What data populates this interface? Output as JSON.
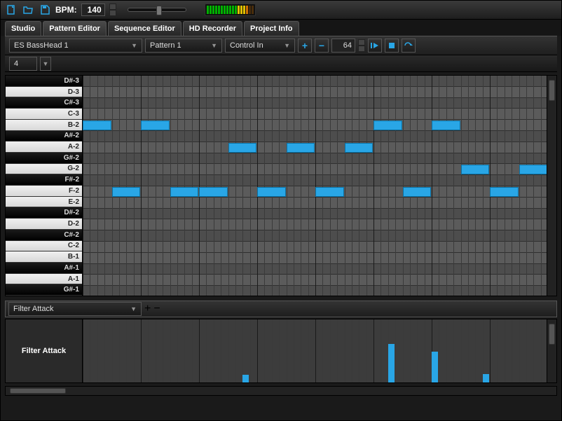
{
  "toolbar": {
    "bpm_label": "BPM:",
    "bpm_value": "140"
  },
  "tabs": [
    "Studio",
    "Pattern Editor",
    "Sequence Editor",
    "HD Recorder",
    "Project Info"
  ],
  "active_tab": 1,
  "sub": {
    "instrument": "ES BassHead 1",
    "pattern": "Pattern 1",
    "control_in": "Control In",
    "steps": "64"
  },
  "zoom": "4",
  "piano": {
    "keys": [
      {
        "n": "D#-3",
        "b": true
      },
      {
        "n": "D-3",
        "b": false
      },
      {
        "n": "C#-3",
        "b": true
      },
      {
        "n": "C-3",
        "b": false
      },
      {
        "n": "B-2",
        "b": false
      },
      {
        "n": "A#-2",
        "b": true
      },
      {
        "n": "A-2",
        "b": false
      },
      {
        "n": "G#-2",
        "b": true
      },
      {
        "n": "G-2",
        "b": false
      },
      {
        "n": "F#-2",
        "b": true
      },
      {
        "n": "F-2",
        "b": false
      },
      {
        "n": "E-2",
        "b": false
      },
      {
        "n": "D#-2",
        "b": true
      },
      {
        "n": "D-2",
        "b": false
      },
      {
        "n": "C#-2",
        "b": true
      },
      {
        "n": "C-2",
        "b": false
      },
      {
        "n": "B-1",
        "b": false
      },
      {
        "n": "A#-1",
        "b": true
      },
      {
        "n": "A-1",
        "b": false
      },
      {
        "n": "G#-1",
        "b": true
      }
    ],
    "notes": [
      {
        "row": 4,
        "start": 0,
        "len": 4
      },
      {
        "row": 4,
        "start": 8,
        "len": 4
      },
      {
        "row": 6,
        "start": 20,
        "len": 4
      },
      {
        "row": 6,
        "start": 28,
        "len": 4
      },
      {
        "row": 6,
        "start": 36,
        "len": 4
      },
      {
        "row": 4,
        "start": 40,
        "len": 4
      },
      {
        "row": 4,
        "start": 48,
        "len": 4
      },
      {
        "row": 8,
        "start": 52,
        "len": 4
      },
      {
        "row": 8,
        "start": 60,
        "len": 4
      },
      {
        "row": 10,
        "start": 4,
        "len": 4
      },
      {
        "row": 10,
        "start": 12,
        "len": 4
      },
      {
        "row": 10,
        "start": 16,
        "len": 4
      },
      {
        "row": 10,
        "start": 24,
        "len": 4
      },
      {
        "row": 10,
        "start": 32,
        "len": 4
      },
      {
        "row": 10,
        "start": 44,
        "len": 4
      },
      {
        "row": 10,
        "start": 56,
        "len": 4
      }
    ],
    "cols": 64
  },
  "automation": {
    "param": "Filter Attack",
    "label": "Filter Attack",
    "points": [
      {
        "c": 22,
        "v": 0.12
      },
      {
        "c": 42,
        "v": 0.62
      },
      {
        "c": 48,
        "v": 0.5
      },
      {
        "c": 55,
        "v": 0.14
      }
    ]
  }
}
